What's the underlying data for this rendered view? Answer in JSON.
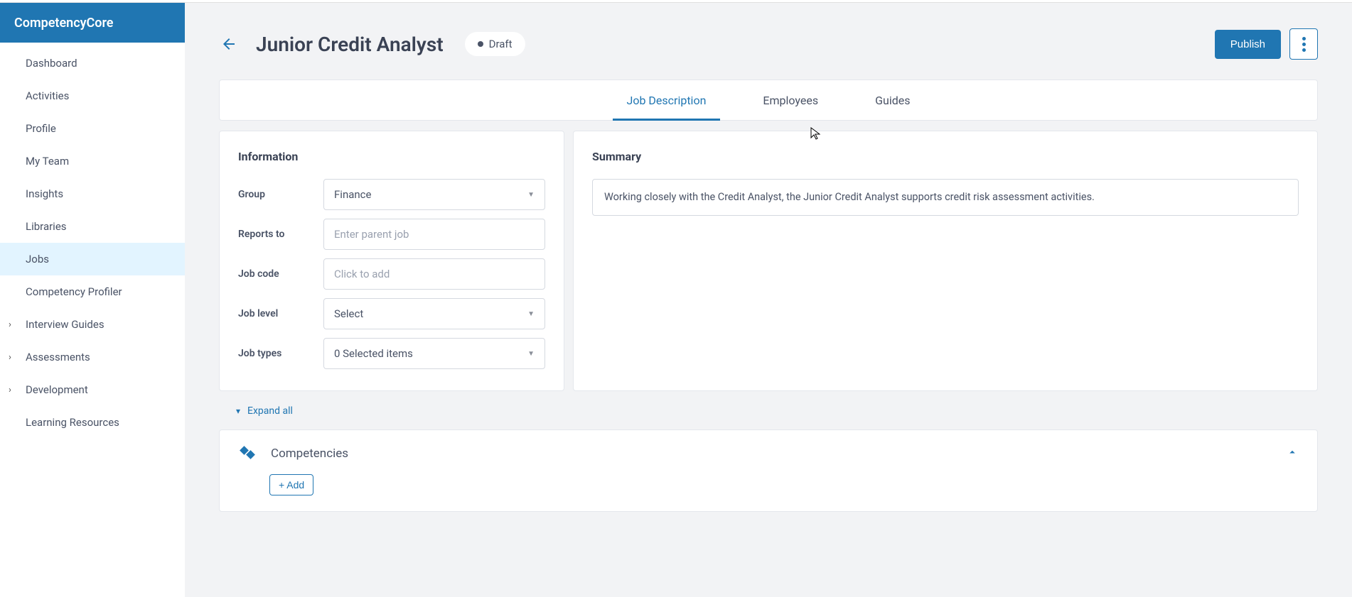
{
  "brand": "CompetencyCore",
  "nav": {
    "items": [
      {
        "label": "Dashboard",
        "chevron": false,
        "active": false
      },
      {
        "label": "Activities",
        "chevron": false,
        "active": false
      },
      {
        "label": "Profile",
        "chevron": false,
        "active": false
      },
      {
        "label": "My Team",
        "chevron": false,
        "active": false
      },
      {
        "label": "Insights",
        "chevron": false,
        "active": false
      },
      {
        "label": "Libraries",
        "chevron": false,
        "active": false
      },
      {
        "label": "Jobs",
        "chevron": false,
        "active": true
      },
      {
        "label": "Competency Profiler",
        "chevron": false,
        "active": false
      },
      {
        "label": "Interview Guides",
        "chevron": true,
        "active": false
      },
      {
        "label": "Assessments",
        "chevron": true,
        "active": false
      },
      {
        "label": "Development",
        "chevron": true,
        "active": false
      },
      {
        "label": "Learning Resources",
        "chevron": false,
        "active": false
      }
    ]
  },
  "header": {
    "title": "Junior Credit Analyst",
    "status": "Draft",
    "publish": "Publish"
  },
  "tabs": [
    {
      "label": "Job Description",
      "active": true
    },
    {
      "label": "Employees",
      "active": false
    },
    {
      "label": "Guides",
      "active": false
    }
  ],
  "info": {
    "heading": "Information",
    "group_label": "Group",
    "group_value": "Finance",
    "reports_label": "Reports to",
    "reports_placeholder": "Enter parent job",
    "code_label": "Job code",
    "code_placeholder": "Click to add",
    "level_label": "Job level",
    "level_value": "Select",
    "types_label": "Job types",
    "types_value": "0 Selected items"
  },
  "summary": {
    "heading": "Summary",
    "text": "Working closely with the Credit Analyst, the Junior Credit Analyst supports credit risk assessment activities."
  },
  "expand_all": "Expand all",
  "competencies": {
    "title": "Competencies",
    "add": "+ Add"
  }
}
